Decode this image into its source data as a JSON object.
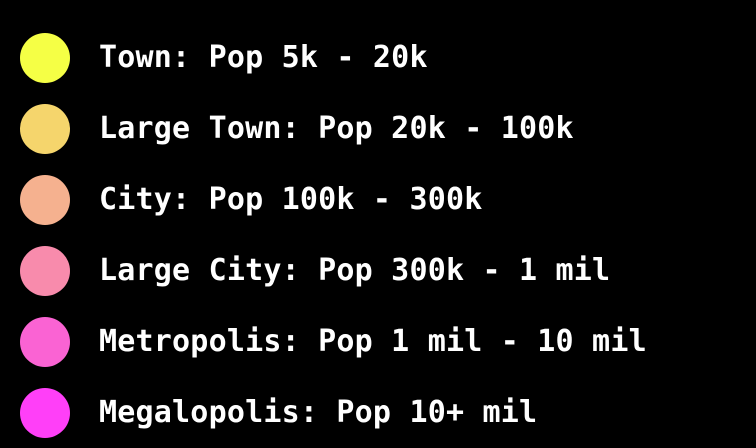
{
  "legend": {
    "items": [
      {
        "label": "Town: Pop 5k - 20k",
        "color": "#f5ff45"
      },
      {
        "label": "Large Town: Pop 20k - 100k",
        "color": "#f5d56c"
      },
      {
        "label": "City: Pop 100k - 300k",
        "color": "#f5b18f"
      },
      {
        "label": "Large City: Pop 300k - 1 mil",
        "color": "#f88bac"
      },
      {
        "label": "Metropolis: Pop 1 mil - 10 mil",
        "color": "#fa63d3"
      },
      {
        "label": "Megalopolis: Pop 10+ mil",
        "color": "#ff3ff8"
      }
    ]
  }
}
